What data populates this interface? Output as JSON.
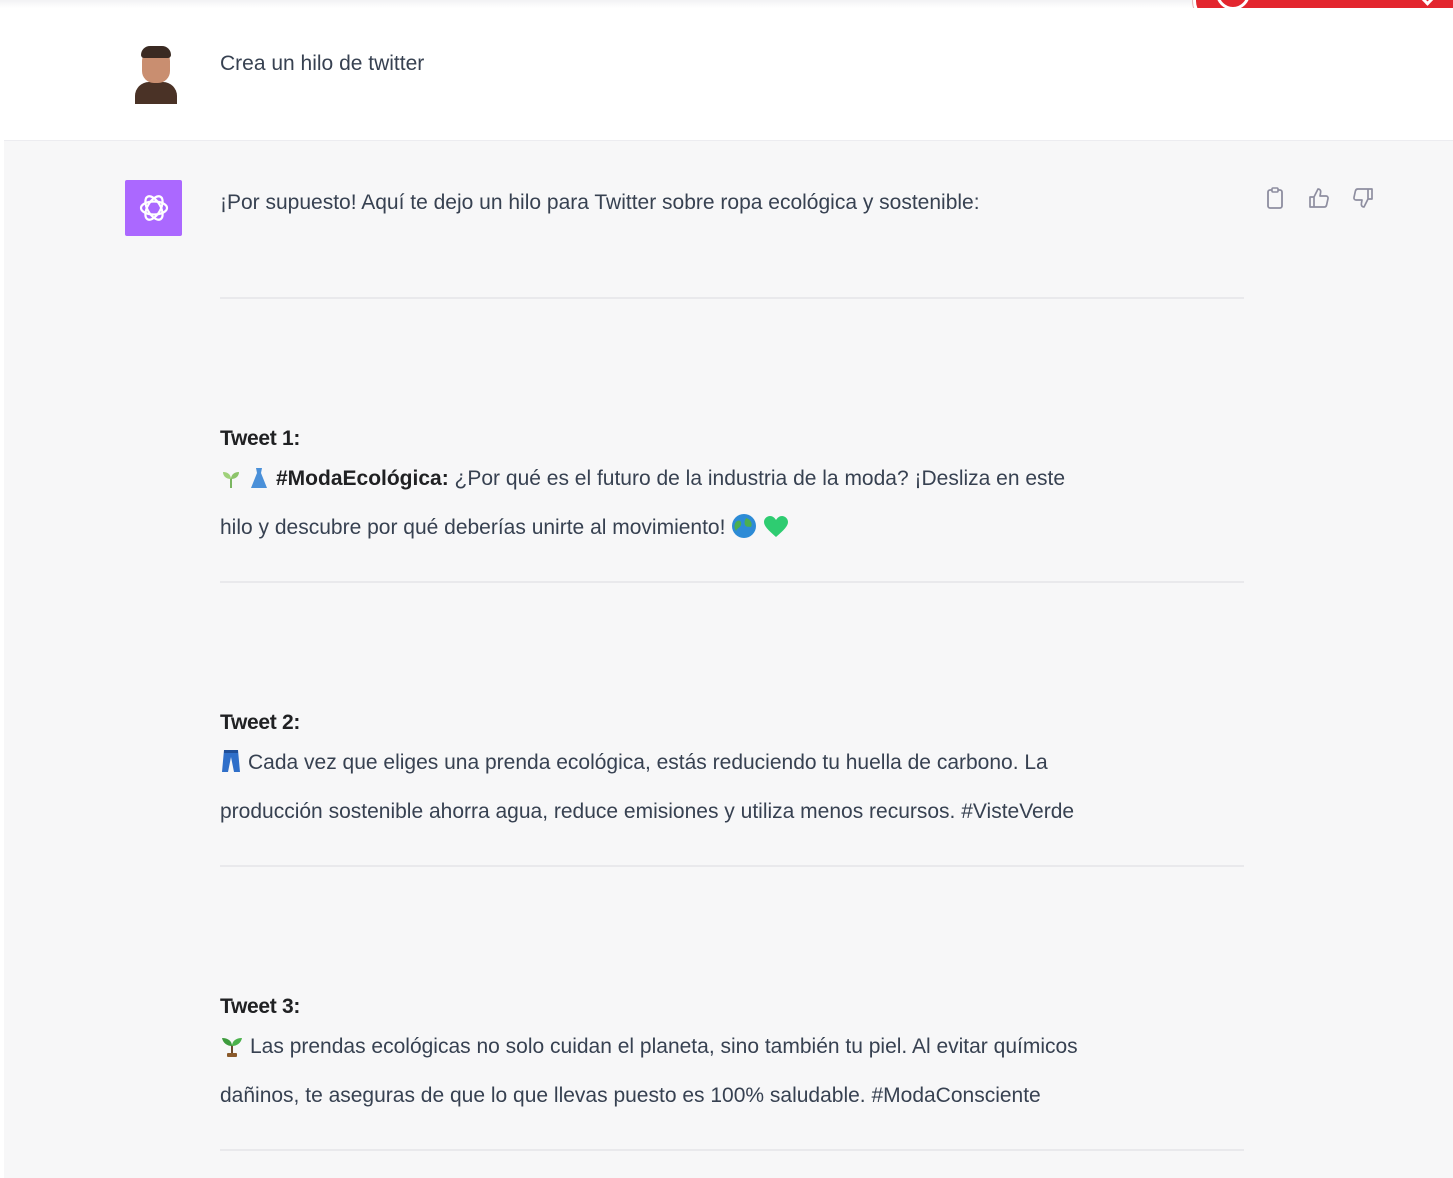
{
  "user": {
    "message": "Crea un hilo de twitter"
  },
  "assistant": {
    "intro": "¡Por supuesto! Aquí te dejo un hilo para Twitter sobre ropa ecológica y sostenible:",
    "tweets": [
      {
        "title": "Tweet 1:",
        "hashtag_lead": "#ModaEcológica:",
        "line1": "¿Por qué es el futuro de la industria de la moda? ¡Desliza en este",
        "line2": "hilo y descubre por qué deberías unirte al movimiento!",
        "emojis": [
          "seedling-icon",
          "dress-icon",
          "earth-icon",
          "green-heart-icon"
        ]
      },
      {
        "title": "Tweet 2:",
        "line1": "Cada vez que eliges una prenda ecológica, estás reduciendo tu huella de carbono. La",
        "line2": "producción sostenible ahorra agua, reduce emisiones y utiliza menos recursos. #VisteVerde",
        "emojis": [
          "jeans-icon"
        ]
      },
      {
        "title": "Tweet 3:",
        "line1": "Las prendas ecológicas no solo cuidan el planeta, sino también tu piel. Al evitar químicos",
        "line2": "dañinos, te aseguras de que lo que llevas puesto es 100% saludable. #ModaConsciente",
        "emojis": [
          "sprout-icon"
        ]
      }
    ]
  },
  "actions": [
    "copy-icon",
    "thumbs-up-icon",
    "thumbs-down-icon"
  ],
  "colors": {
    "bot_avatar": "#ab68ff",
    "assistant_bg": "#f7f7f8",
    "badge_red": "#e3262e"
  }
}
